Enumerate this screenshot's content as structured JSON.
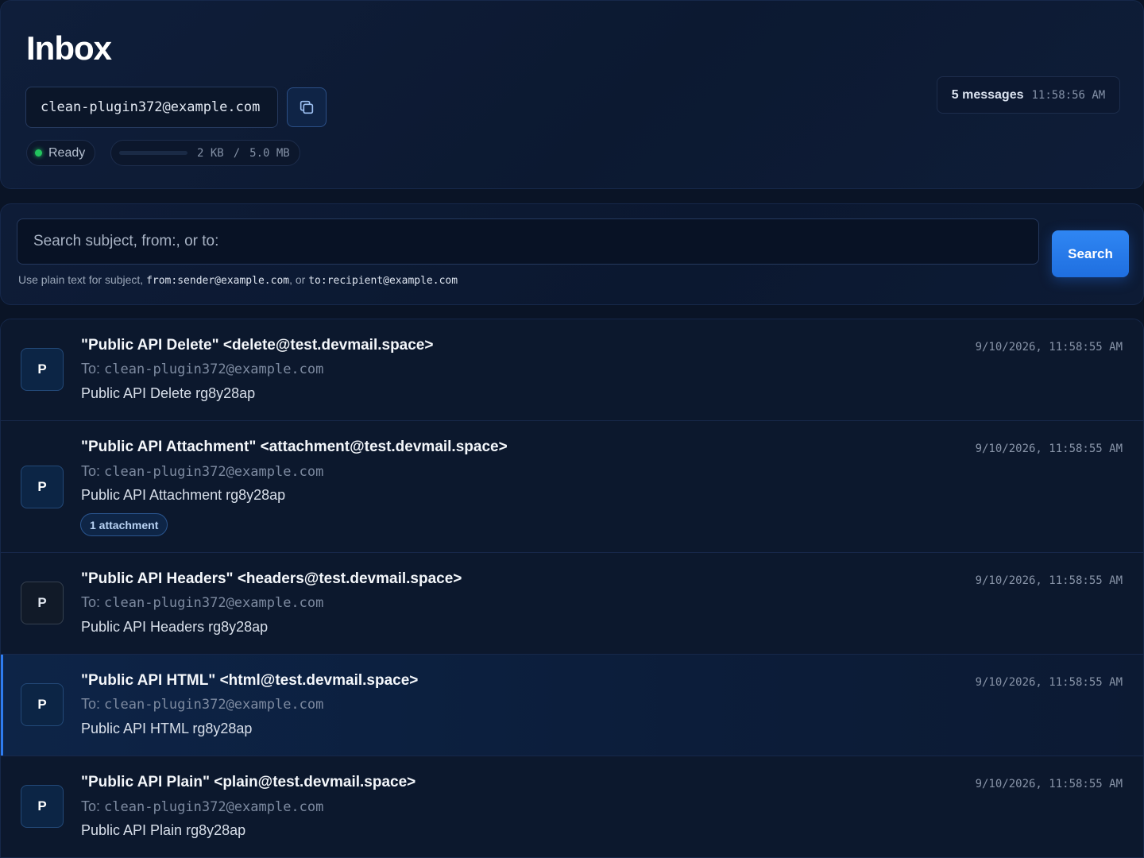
{
  "inbox": {
    "title": "Inbox",
    "address": "clean-plugin372@example.com",
    "copy_icon": "copy-icon",
    "status": "Ready",
    "status_color": "#22c55e",
    "storage_used": "2 KB",
    "storage_separator": "/",
    "storage_total": "5.0 MB",
    "storage_fraction": 0.0004,
    "message_count": "5 messages",
    "last_updated": "11:58:56 AM"
  },
  "search": {
    "placeholder": "Search subject, from:, or to:",
    "button_label": "Search",
    "hint_prefix": "Use plain text for subject,",
    "hint_from": "from:sender@example.com",
    "hint_or": ", or",
    "hint_to": "to:recipient@example.com"
  },
  "messages": [
    {
      "avatar": "P",
      "sender": "\"Public API Delete\" <delete@test.devmail.space>",
      "to_label": "To:",
      "to": "clean-plugin372@example.com",
      "subject": "Public API Delete rg8y28ap",
      "time": "9/10/2026, 11:58:55 AM"
    },
    {
      "avatar": "P",
      "sender": "\"Public API Attachment\" <attachment@test.devmail.space>",
      "to_label": "To:",
      "to": "clean-plugin372@example.com",
      "subject": "Public API Attachment rg8y28ap",
      "time": "9/10/2026, 11:58:55 AM",
      "attachments": "1 attachment"
    },
    {
      "avatar": "P",
      "sender": "\"Public API Headers\" <headers@test.devmail.space>",
      "to_label": "To:",
      "to": "clean-plugin372@example.com",
      "subject": "Public API Headers rg8y28ap",
      "time": "9/10/2026, 11:58:55 AM"
    },
    {
      "avatar": "P",
      "sender": "\"Public API HTML\" <html@test.devmail.space>",
      "to_label": "To:",
      "to": "clean-plugin372@example.com",
      "subject": "Public API HTML rg8y28ap",
      "time": "9/10/2026, 11:58:55 AM"
    },
    {
      "avatar": "P",
      "sender": "\"Public API Plain\" <plain@test.devmail.space>",
      "to_label": "To:",
      "to": "clean-plugin372@example.com",
      "subject": "Public API Plain rg8y28ap",
      "time": "9/10/2026, 11:58:55 AM"
    }
  ],
  "colors": {
    "accent": "#2f86f3",
    "background": "#0a1426",
    "selected_row_accent": "#2e7cf0"
  }
}
